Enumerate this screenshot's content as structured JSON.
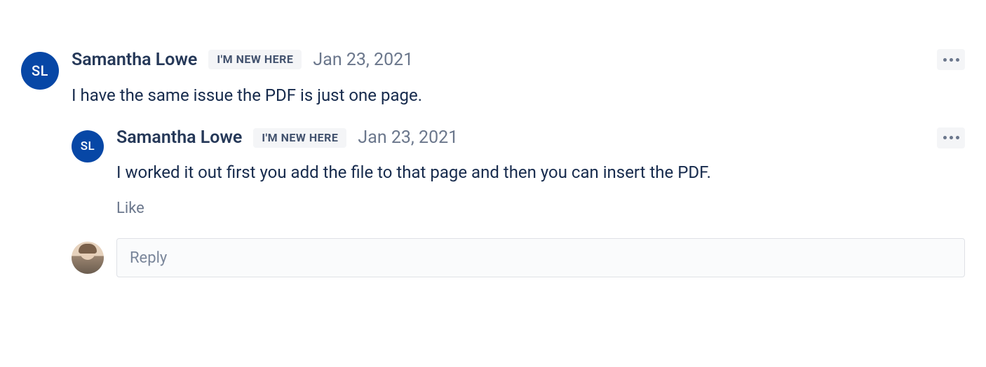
{
  "comment": {
    "author_initials": "SL",
    "author_name": "Samantha Lowe",
    "badge": "I'M NEW HERE",
    "date": "Jan 23, 2021",
    "text": "I have the same issue the PDF is just one page.",
    "reply": {
      "author_initials": "SL",
      "author_name": "Samantha Lowe",
      "badge": "I'M NEW HERE",
      "date": "Jan 23, 2021",
      "text": "I worked it out first you add the file to that page and then you can insert the PDF.",
      "like_label": "Like"
    },
    "reply_placeholder": "Reply"
  }
}
